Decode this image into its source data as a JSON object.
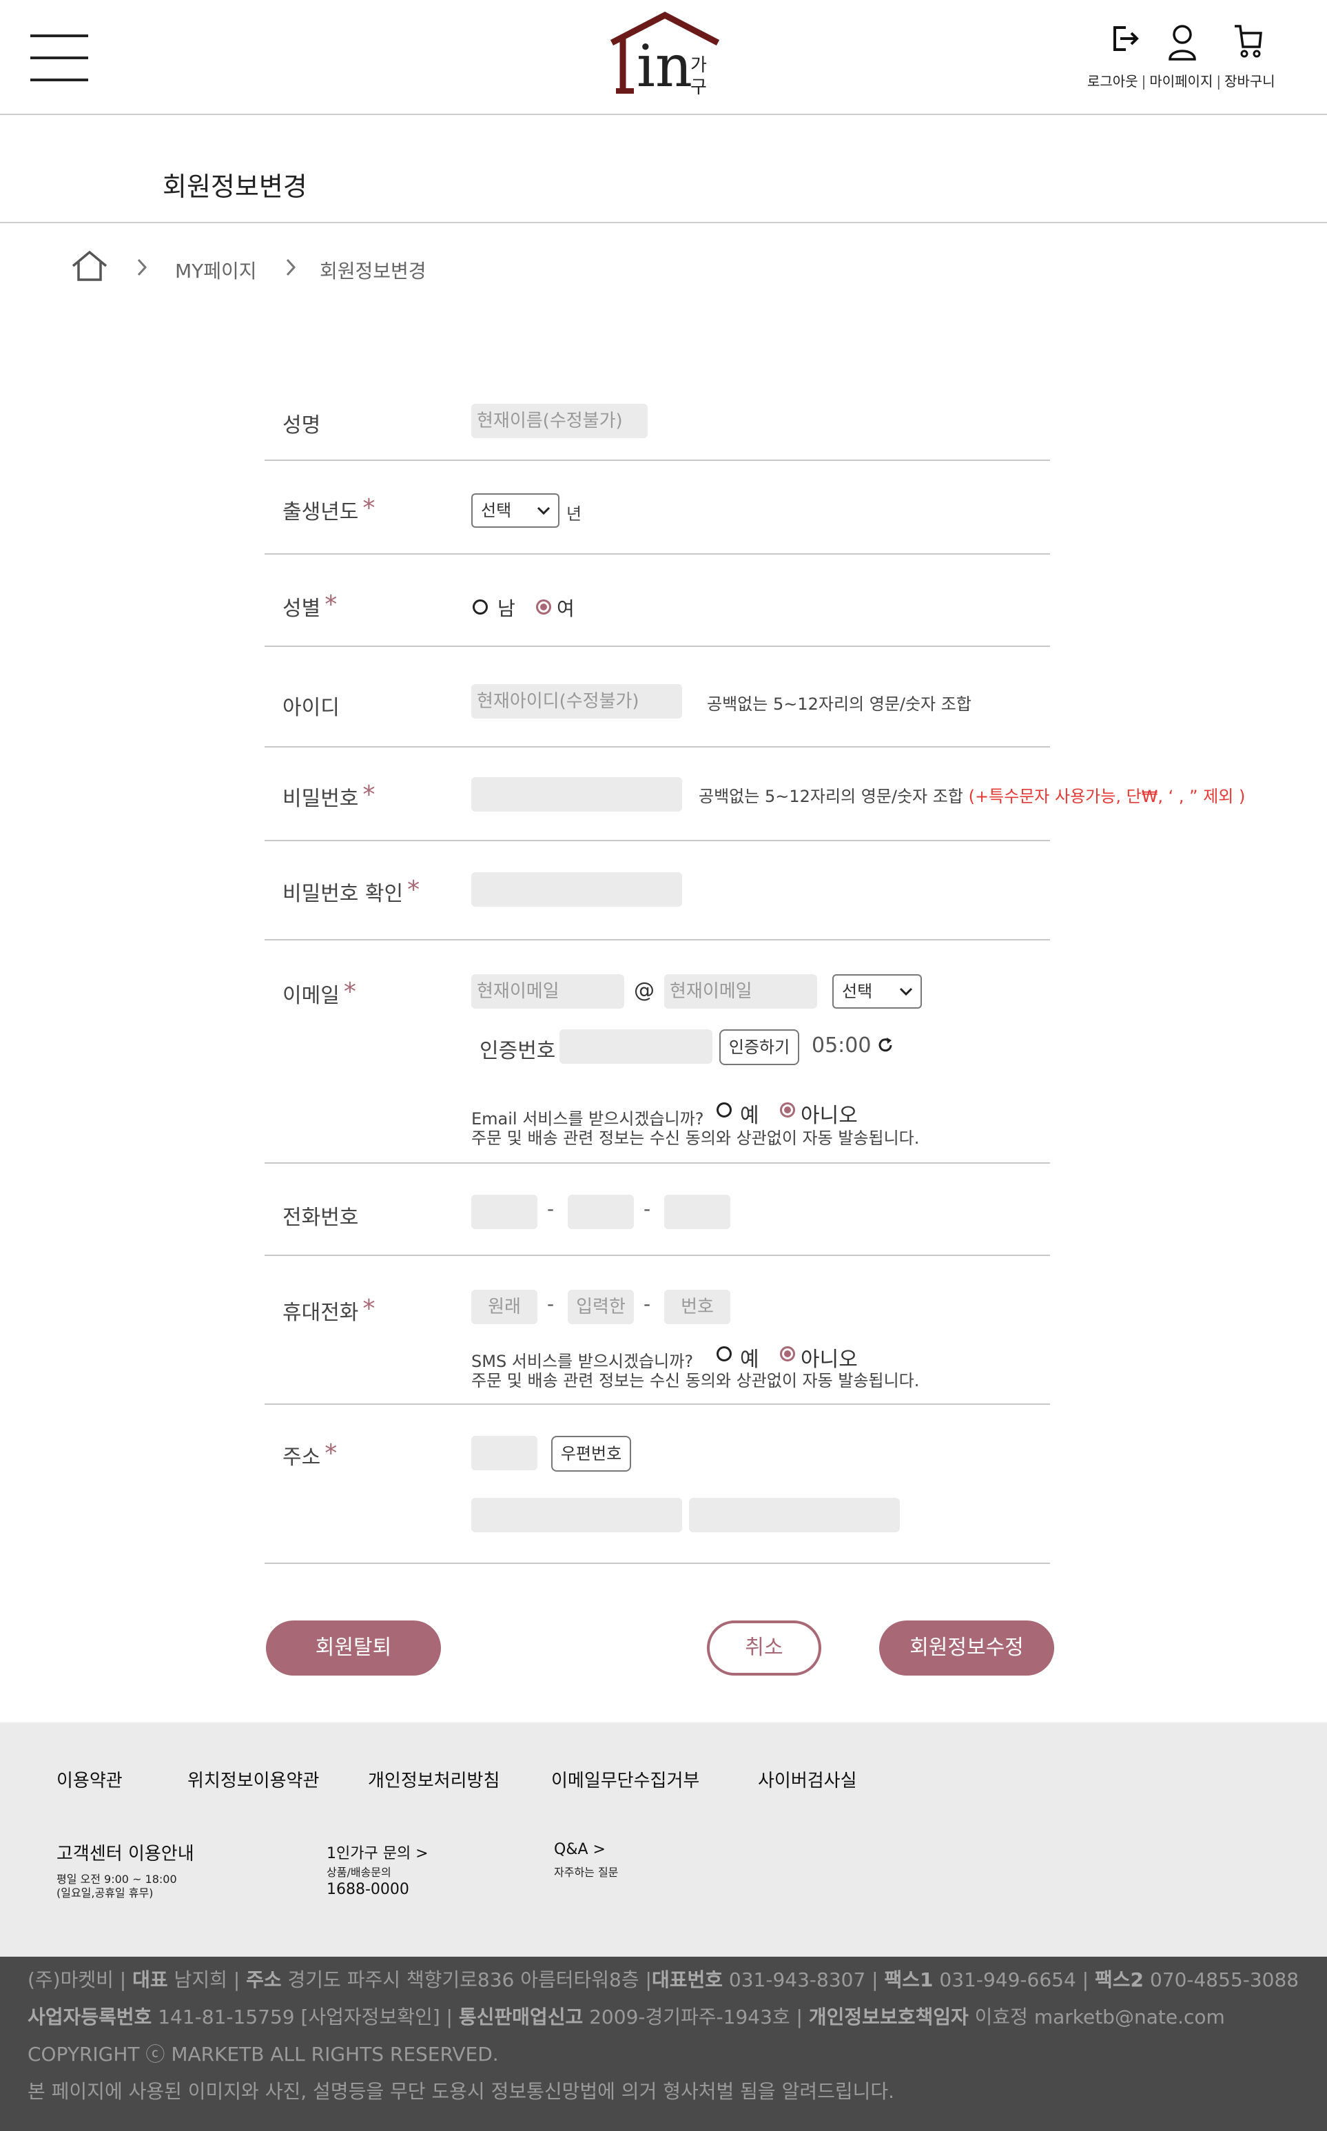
{
  "header": {
    "logo_text": "in",
    "logo_sub1": "가",
    "logo_sub2": "구",
    "links": [
      "로그아웃",
      "마이페이지",
      "장바구니"
    ]
  },
  "page_title": "회원정보변경",
  "breadcrumb": [
    "MY페이지",
    "회원정보변경"
  ],
  "form": {
    "name": {
      "label": "성명",
      "placeholder": "현재이름(수정불가)"
    },
    "birth": {
      "label": "출생년도",
      "select": "선택",
      "suffix": "년"
    },
    "gender": {
      "label": "성별",
      "options": [
        "남",
        "여"
      ],
      "selected": "여"
    },
    "id": {
      "label": "아이디",
      "placeholder": "현재아이디(수정불가)",
      "hint": "공백없는 5~12자리의 영문/숫자 조합"
    },
    "password": {
      "label": "비밀번호",
      "hint": "공백없는 5~12자리의 영문/숫자 조합",
      "hint_red": "(+특수문자 사용가능, 단₩, ‘ , ” 제외 )"
    },
    "password_confirm": {
      "label": "비밀번호 확인"
    },
    "email": {
      "label": "이메일",
      "local_placeholder": "현재이메일",
      "at": "@",
      "domain_placeholder": "현재이메일",
      "select": "선택",
      "verify_label": "인증번호",
      "verify_button": "인증하기",
      "timer": "05:00",
      "consent_question": "Email 서비스를 받으시겠습니까?",
      "consent_options": [
        "예",
        "아니오"
      ],
      "consent_selected": "아니오",
      "consent_note": "주문 및 배송 관련 정보는 수신 동의와 상관없이 자동 발송됩니다."
    },
    "phone": {
      "label": "전화번호",
      "dash": "-"
    },
    "mobile": {
      "label": "휴대전화",
      "placeholders": [
        "원래",
        "입력한",
        "번호"
      ],
      "consent_question": "SMS 서비스를 받으시겠습니까?",
      "consent_options": [
        "예",
        "아니오"
      ],
      "consent_selected": "아니오",
      "consent_note": "주문 및 배송 관련 정보는 수신 동의와 상관없이 자동 발송됩니다."
    },
    "address": {
      "label": "주소",
      "zip_button": "우편번호"
    },
    "required_mark": "*"
  },
  "buttons": {
    "withdraw": "회원탈퇴",
    "cancel": "취소",
    "submit": "회원정보수정"
  },
  "footer": {
    "links": [
      "이용약관",
      "위치정보이용약관",
      "개인정보처리방침",
      "이메일무단수집거부",
      "사이버검사실"
    ],
    "cs_title": "고객센터 이용안내",
    "cs_hours": "평일 오전 9:00 ~ 18:00",
    "cs_holiday": "(일요일,공휴일 휴무)",
    "inquiry_title": "1인가구 문의 >",
    "inquiry_sub": "상품/배송문의",
    "inquiry_phone": "1688-0000",
    "qa_title": "Q&A >",
    "qa_sub": "자주하는 질문",
    "company": {
      "line1_parts": [
        {
          "t": "(주)마켓비",
          "b": false
        },
        {
          "t": "  |  ",
          "b": false
        },
        {
          "t": "대표",
          "b": true
        },
        {
          "t": " 남지희  |  ",
          "b": false
        },
        {
          "t": "주소",
          "b": true
        },
        {
          "t": " 경기도 파주시 책향기로836 아름터타워8층  |",
          "b": false
        },
        {
          "t": "대표번호",
          "b": true
        },
        {
          "t": " 031-943-8307  |  ",
          "b": false
        },
        {
          "t": "팩스1",
          "b": true
        },
        {
          "t": " 031-949-6654  |  ",
          "b": false
        },
        {
          "t": "팩스2",
          "b": true
        },
        {
          "t": " 070-4855-3088",
          "b": false
        }
      ],
      "line2_parts": [
        {
          "t": "사업자등록번호",
          "b": true
        },
        {
          "t": " 141-81-15759 [사업자정보확인]  |  ",
          "b": false
        },
        {
          "t": "통신판매업신고",
          "b": true
        },
        {
          "t": " 2009-경기파주-1943호  |  ",
          "b": false
        },
        {
          "t": "개인정보보호책임자",
          "b": true
        },
        {
          "t": " 이효정  marketb@nate.com",
          "b": false
        }
      ],
      "copyright": "COPYRIGHT ⓒ MARKETB ALL RIGHTS RESERVED.",
      "notice": "본 페이지에 사용된 이미지와 사진, 설명등을 무단 도용시 정보통신망법에 의거 형사처벌 됨을 알려드립니다."
    }
  },
  "colors": {
    "accent": "#a86876",
    "warning": "#e53935",
    "footer_bg": "#ebebeb",
    "footer_dark": "#4a4a4a"
  }
}
